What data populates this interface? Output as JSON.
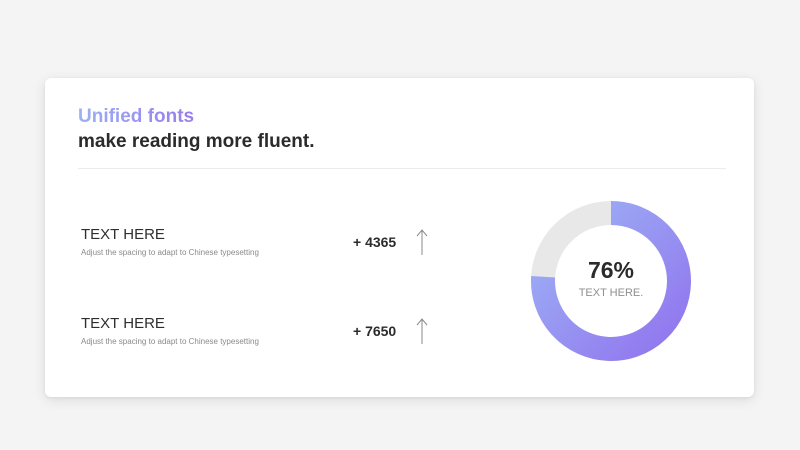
{
  "heading": {
    "accent": "Unified fonts",
    "main": "make reading more fluent."
  },
  "stats": [
    {
      "title": "TEXT HERE",
      "subtitle": "Adjust the spacing to adapt to Chinese typesetting",
      "value": "+ 4365",
      "icon": "arrow-up-icon"
    },
    {
      "title": "TEXT HERE",
      "subtitle": "Adjust the spacing to adapt to Chinese typesetting",
      "value": "+ 7650",
      "icon": "arrow-up-icon"
    }
  ],
  "donut": {
    "value": 76,
    "value_text": "76%",
    "label": "TEXT HERE.",
    "colors": {
      "track": "#e8e8e8",
      "gradient_start": "#9db4f5",
      "gradient_end": "#9174ee"
    }
  }
}
